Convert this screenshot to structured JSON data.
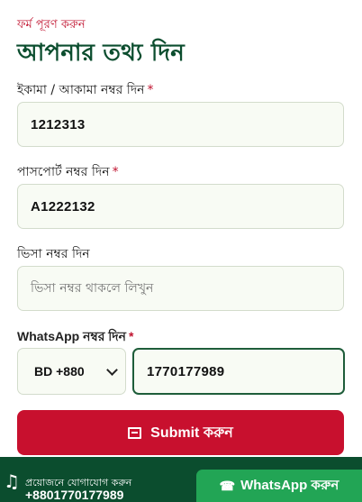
{
  "form": {
    "eyebrow": "ফর্ম পূরণ করুন",
    "heading": "আপনার তথ্য দিন",
    "iqama": {
      "label": "ইকামা / আকামা নম্বর দিন",
      "required": "*",
      "value": "1212313"
    },
    "passport": {
      "label": "পাসপোর্ট নম্বর দিন",
      "required": "*",
      "value": "A1222132"
    },
    "visa": {
      "label": "ভিসা নম্বর দিন",
      "placeholder": "ভিসা নম্বর থাকলে লিখুন",
      "value": ""
    },
    "whatsapp": {
      "label": "WhatsApp নম্বর দিন",
      "required": "*",
      "country_code": "BD +880",
      "number": "1770177989"
    },
    "submit_label": "Submit করুন"
  },
  "footer": {
    "contact_label": "প্রয়োজনে যোগাযোগ করুন",
    "contact_phone": "+8801770177989",
    "whatsapp_button": "WhatsApp করুন"
  },
  "colors": {
    "brand_green": "#0b4d2e",
    "accent_red": "#c8102e",
    "whatsapp_green": "#22a555"
  }
}
